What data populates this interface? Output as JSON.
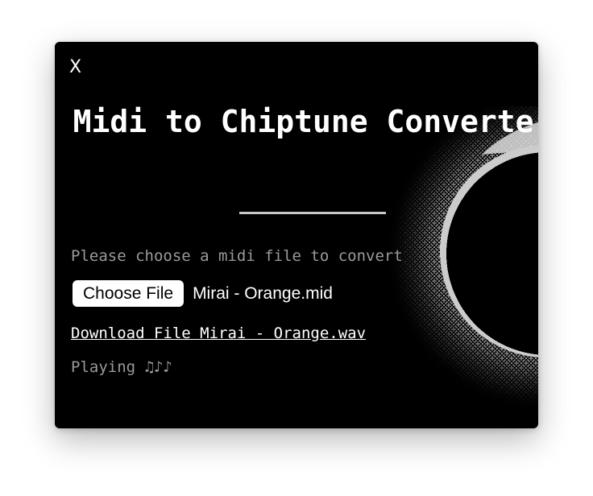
{
  "dialog": {
    "close_label": "X",
    "title": "Midi to Chiptune Converter",
    "prompt": "Please choose a midi file to convert",
    "file_input": {
      "button_label": "Choose File",
      "file_name": "Mirai - Orange.mid"
    },
    "download_link": "Download File Mirai - Orange.wav",
    "status": "Playing ♫♪♪"
  },
  "icons": {
    "eclipse": "eclipse-art-icon"
  },
  "colors": {
    "background": "#000000",
    "text": "#ffffff",
    "muted_text": "#9a9a9a",
    "divider": "#c8c8c8",
    "button_bg": "#ffffff"
  }
}
